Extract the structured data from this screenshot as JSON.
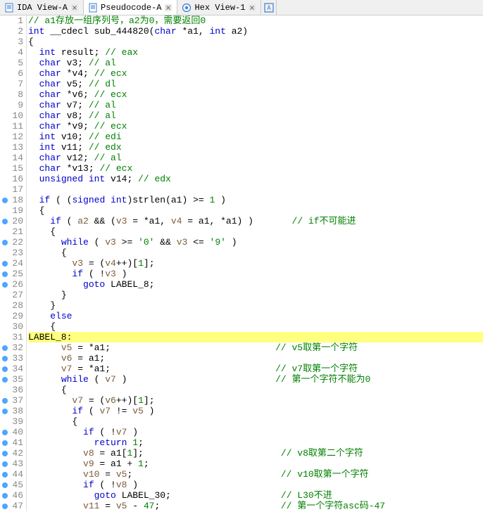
{
  "tabs": [
    {
      "label": "IDA View-A",
      "icon": "doc-blue",
      "active": false
    },
    {
      "label": "Pseudocode-A",
      "icon": "doc-blue",
      "active": true
    },
    {
      "label": "Hex View-1",
      "icon": "hex-blue",
      "active": false
    }
  ],
  "extra_icon": "struct-icon",
  "code": {
    "lines": [
      {
        "n": 1,
        "dot": false,
        "tokens": [
          [
            "c-comment",
            "// a1存放一组序列号，a2为0，需要返回0"
          ]
        ]
      },
      {
        "n": 2,
        "dot": false,
        "tokens": [
          [
            "c-type",
            "int"
          ],
          [
            "c-plain",
            " __cdecl "
          ],
          [
            "c-func",
            "sub_444820"
          ],
          [
            "c-plain",
            "("
          ],
          [
            "c-type",
            "char"
          ],
          [
            "c-plain",
            " *a1, "
          ],
          [
            "c-type",
            "int"
          ],
          [
            "c-plain",
            " a2)"
          ]
        ]
      },
      {
        "n": 3,
        "dot": false,
        "tokens": [
          [
            "c-brace",
            "{"
          ]
        ]
      },
      {
        "n": 4,
        "dot": false,
        "tokens": [
          [
            "c-plain",
            "  "
          ],
          [
            "c-type",
            "int"
          ],
          [
            "c-plain",
            " result; "
          ],
          [
            "c-comment",
            "// eax"
          ]
        ]
      },
      {
        "n": 5,
        "dot": false,
        "tokens": [
          [
            "c-plain",
            "  "
          ],
          [
            "c-type",
            "char"
          ],
          [
            "c-plain",
            " v3; "
          ],
          [
            "c-comment",
            "// al"
          ]
        ]
      },
      {
        "n": 6,
        "dot": false,
        "tokens": [
          [
            "c-plain",
            "  "
          ],
          [
            "c-type",
            "char"
          ],
          [
            "c-plain",
            " *v4; "
          ],
          [
            "c-comment",
            "// ecx"
          ]
        ]
      },
      {
        "n": 7,
        "dot": false,
        "tokens": [
          [
            "c-plain",
            "  "
          ],
          [
            "c-type",
            "char"
          ],
          [
            "c-plain",
            " v5; "
          ],
          [
            "c-comment",
            "// dl"
          ]
        ]
      },
      {
        "n": 8,
        "dot": false,
        "tokens": [
          [
            "c-plain",
            "  "
          ],
          [
            "c-type",
            "char"
          ],
          [
            "c-plain",
            " *v6; "
          ],
          [
            "c-comment",
            "// ecx"
          ]
        ]
      },
      {
        "n": 9,
        "dot": false,
        "tokens": [
          [
            "c-plain",
            "  "
          ],
          [
            "c-type",
            "char"
          ],
          [
            "c-plain",
            " v7; "
          ],
          [
            "c-comment",
            "// al"
          ]
        ]
      },
      {
        "n": 10,
        "dot": false,
        "tokens": [
          [
            "c-plain",
            "  "
          ],
          [
            "c-type",
            "char"
          ],
          [
            "c-plain",
            " v8; "
          ],
          [
            "c-comment",
            "// al"
          ]
        ]
      },
      {
        "n": 11,
        "dot": false,
        "tokens": [
          [
            "c-plain",
            "  "
          ],
          [
            "c-type",
            "char"
          ],
          [
            "c-plain",
            " *v9; "
          ],
          [
            "c-comment",
            "// ecx"
          ]
        ]
      },
      {
        "n": 12,
        "dot": false,
        "tokens": [
          [
            "c-plain",
            "  "
          ],
          [
            "c-type",
            "int"
          ],
          [
            "c-plain",
            " v10; "
          ],
          [
            "c-comment",
            "// edi"
          ]
        ]
      },
      {
        "n": 13,
        "dot": false,
        "tokens": [
          [
            "c-plain",
            "  "
          ],
          [
            "c-type",
            "int"
          ],
          [
            "c-plain",
            " v11; "
          ],
          [
            "c-comment",
            "// edx"
          ]
        ]
      },
      {
        "n": 14,
        "dot": false,
        "tokens": [
          [
            "c-plain",
            "  "
          ],
          [
            "c-type",
            "char"
          ],
          [
            "c-plain",
            " v12; "
          ],
          [
            "c-comment",
            "// al"
          ]
        ]
      },
      {
        "n": 15,
        "dot": false,
        "tokens": [
          [
            "c-plain",
            "  "
          ],
          [
            "c-type",
            "char"
          ],
          [
            "c-plain",
            " *v13; "
          ],
          [
            "c-comment",
            "// ecx"
          ]
        ]
      },
      {
        "n": 16,
        "dot": false,
        "tokens": [
          [
            "c-plain",
            "  "
          ],
          [
            "c-type",
            "unsigned int"
          ],
          [
            "c-plain",
            " v14; "
          ],
          [
            "c-comment",
            "// edx"
          ]
        ]
      },
      {
        "n": 17,
        "dot": false,
        "tokens": [
          [
            "c-plain",
            ""
          ]
        ]
      },
      {
        "n": 18,
        "dot": true,
        "tokens": [
          [
            "c-plain",
            "  "
          ],
          [
            "c-keyword",
            "if"
          ],
          [
            "c-plain",
            " ( ("
          ],
          [
            "c-type",
            "signed int"
          ],
          [
            "c-plain",
            ")"
          ],
          [
            "c-func",
            "strlen"
          ],
          [
            "c-plain",
            "(a1) >= "
          ],
          [
            "c-num",
            "1"
          ],
          [
            "c-plain",
            " )"
          ]
        ]
      },
      {
        "n": 19,
        "dot": false,
        "tokens": [
          [
            "c-plain",
            "  "
          ],
          [
            "c-brace",
            "{"
          ]
        ]
      },
      {
        "n": 20,
        "dot": true,
        "tokens": [
          [
            "c-plain",
            "    "
          ],
          [
            "c-keyword",
            "if"
          ],
          [
            "c-plain",
            " ( "
          ],
          [
            "c-id",
            "a2"
          ],
          [
            "c-plain",
            " && ("
          ],
          [
            "c-id",
            "v3"
          ],
          [
            "c-plain",
            " = *a1, "
          ],
          [
            "c-id",
            "v4"
          ],
          [
            "c-plain",
            " = a1, *a1) )       "
          ],
          [
            "c-comment",
            "// if不可能进"
          ]
        ]
      },
      {
        "n": 21,
        "dot": false,
        "tokens": [
          [
            "c-plain",
            "    "
          ],
          [
            "c-brace",
            "{"
          ]
        ]
      },
      {
        "n": 22,
        "dot": true,
        "tokens": [
          [
            "c-plain",
            "      "
          ],
          [
            "c-keyword",
            "while"
          ],
          [
            "c-plain",
            " ( "
          ],
          [
            "c-id",
            "v3"
          ],
          [
            "c-plain",
            " >= "
          ],
          [
            "c-str",
            "'0'"
          ],
          [
            "c-plain",
            " && "
          ],
          [
            "c-id",
            "v3"
          ],
          [
            "c-plain",
            " <= "
          ],
          [
            "c-str",
            "'9'"
          ],
          [
            "c-plain",
            " )"
          ]
        ]
      },
      {
        "n": 23,
        "dot": false,
        "tokens": [
          [
            "c-plain",
            "      "
          ],
          [
            "c-brace",
            "{"
          ]
        ]
      },
      {
        "n": 24,
        "dot": true,
        "tokens": [
          [
            "c-plain",
            "        "
          ],
          [
            "c-id",
            "v3"
          ],
          [
            "c-plain",
            " = ("
          ],
          [
            "c-id",
            "v4"
          ],
          [
            "c-plain",
            "++)["
          ],
          [
            "c-num",
            "1"
          ],
          [
            "c-plain",
            "];"
          ]
        ]
      },
      {
        "n": 25,
        "dot": true,
        "tokens": [
          [
            "c-plain",
            "        "
          ],
          [
            "c-keyword",
            "if"
          ],
          [
            "c-plain",
            " ( !"
          ],
          [
            "c-id",
            "v3"
          ],
          [
            "c-plain",
            " )"
          ]
        ]
      },
      {
        "n": 26,
        "dot": true,
        "tokens": [
          [
            "c-plain",
            "          "
          ],
          [
            "c-keyword",
            "goto"
          ],
          [
            "c-plain",
            " LABEL_8;"
          ]
        ]
      },
      {
        "n": 27,
        "dot": false,
        "tokens": [
          [
            "c-plain",
            "      "
          ],
          [
            "c-brace",
            "}"
          ]
        ]
      },
      {
        "n": 28,
        "dot": false,
        "tokens": [
          [
            "c-plain",
            "    "
          ],
          [
            "c-brace",
            "}"
          ]
        ]
      },
      {
        "n": 29,
        "dot": false,
        "tokens": [
          [
            "c-plain",
            "    "
          ],
          [
            "c-keyword",
            "else"
          ]
        ]
      },
      {
        "n": 30,
        "dot": false,
        "tokens": [
          [
            "c-plain",
            "    "
          ],
          [
            "c-brace",
            "{"
          ]
        ]
      },
      {
        "n": 31,
        "dot": false,
        "tokens": [
          [
            "c-label",
            "LABEL_8:"
          ]
        ],
        "hl": true
      },
      {
        "n": 32,
        "dot": true,
        "tokens": [
          [
            "c-plain",
            "      "
          ],
          [
            "c-id",
            "v5"
          ],
          [
            "c-plain",
            " = *a1;                              "
          ],
          [
            "c-comment",
            "// v5取第一个字符"
          ]
        ]
      },
      {
        "n": 33,
        "dot": true,
        "tokens": [
          [
            "c-plain",
            "      "
          ],
          [
            "c-id",
            "v6"
          ],
          [
            "c-plain",
            " = a1;"
          ]
        ]
      },
      {
        "n": 34,
        "dot": true,
        "tokens": [
          [
            "c-plain",
            "      "
          ],
          [
            "c-id",
            "v7"
          ],
          [
            "c-plain",
            " = *a1;                              "
          ],
          [
            "c-comment",
            "// v7取第一个字符"
          ]
        ]
      },
      {
        "n": 35,
        "dot": true,
        "tokens": [
          [
            "c-plain",
            "      "
          ],
          [
            "c-keyword",
            "while"
          ],
          [
            "c-plain",
            " ( "
          ],
          [
            "c-id",
            "v7"
          ],
          [
            "c-plain",
            " )                           "
          ],
          [
            "c-comment",
            "// 第一个字符不能为0"
          ]
        ]
      },
      {
        "n": 36,
        "dot": false,
        "tokens": [
          [
            "c-plain",
            "      "
          ],
          [
            "c-brace",
            "{"
          ]
        ]
      },
      {
        "n": 37,
        "dot": true,
        "tokens": [
          [
            "c-plain",
            "        "
          ],
          [
            "c-id",
            "v7"
          ],
          [
            "c-plain",
            " = ("
          ],
          [
            "c-id",
            "v6"
          ],
          [
            "c-plain",
            "++)["
          ],
          [
            "c-num",
            "1"
          ],
          [
            "c-plain",
            "];"
          ]
        ]
      },
      {
        "n": 38,
        "dot": true,
        "tokens": [
          [
            "c-plain",
            "        "
          ],
          [
            "c-keyword",
            "if"
          ],
          [
            "c-plain",
            " ( "
          ],
          [
            "c-id",
            "v7"
          ],
          [
            "c-plain",
            " != "
          ],
          [
            "c-id",
            "v5"
          ],
          [
            "c-plain",
            " )"
          ]
        ]
      },
      {
        "n": 39,
        "dot": false,
        "tokens": [
          [
            "c-plain",
            "        "
          ],
          [
            "c-brace",
            "{"
          ]
        ]
      },
      {
        "n": 40,
        "dot": true,
        "tokens": [
          [
            "c-plain",
            "          "
          ],
          [
            "c-keyword",
            "if"
          ],
          [
            "c-plain",
            " ( !"
          ],
          [
            "c-id",
            "v7"
          ],
          [
            "c-plain",
            " )"
          ]
        ]
      },
      {
        "n": 41,
        "dot": true,
        "tokens": [
          [
            "c-plain",
            "            "
          ],
          [
            "c-keyword",
            "return"
          ],
          [
            "c-plain",
            " "
          ],
          [
            "c-num",
            "1"
          ],
          [
            "c-plain",
            ";"
          ]
        ]
      },
      {
        "n": 42,
        "dot": true,
        "tokens": [
          [
            "c-plain",
            "          "
          ],
          [
            "c-id",
            "v8"
          ],
          [
            "c-plain",
            " = a1["
          ],
          [
            "c-num",
            "1"
          ],
          [
            "c-plain",
            "];                         "
          ],
          [
            "c-comment",
            "// v8取第二个字符"
          ]
        ]
      },
      {
        "n": 43,
        "dot": true,
        "tokens": [
          [
            "c-plain",
            "          "
          ],
          [
            "c-id",
            "v9"
          ],
          [
            "c-plain",
            " = a1 + "
          ],
          [
            "c-num",
            "1"
          ],
          [
            "c-plain",
            ";"
          ]
        ]
      },
      {
        "n": 44,
        "dot": true,
        "tokens": [
          [
            "c-plain",
            "          "
          ],
          [
            "c-id",
            "v10"
          ],
          [
            "c-plain",
            " = "
          ],
          [
            "c-id",
            "v5"
          ],
          [
            "c-plain",
            ";                           "
          ],
          [
            "c-comment",
            "// v10取第一个字符"
          ]
        ]
      },
      {
        "n": 45,
        "dot": true,
        "tokens": [
          [
            "c-plain",
            "          "
          ],
          [
            "c-keyword",
            "if"
          ],
          [
            "c-plain",
            " ( !"
          ],
          [
            "c-id",
            "v8"
          ],
          [
            "c-plain",
            " )"
          ]
        ]
      },
      {
        "n": 46,
        "dot": true,
        "tokens": [
          [
            "c-plain",
            "            "
          ],
          [
            "c-keyword",
            "goto"
          ],
          [
            "c-plain",
            " LABEL_30;                    "
          ],
          [
            "c-comment",
            "// L30不进"
          ]
        ]
      },
      {
        "n": 47,
        "dot": true,
        "tokens": [
          [
            "c-plain",
            "          "
          ],
          [
            "c-id",
            "v11"
          ],
          [
            "c-plain",
            " = "
          ],
          [
            "c-id",
            "v5"
          ],
          [
            "c-plain",
            " - "
          ],
          [
            "c-num",
            "47"
          ],
          [
            "c-plain",
            ";                      "
          ],
          [
            "c-comment",
            "// 第一个字符asc码-47"
          ]
        ]
      }
    ]
  }
}
